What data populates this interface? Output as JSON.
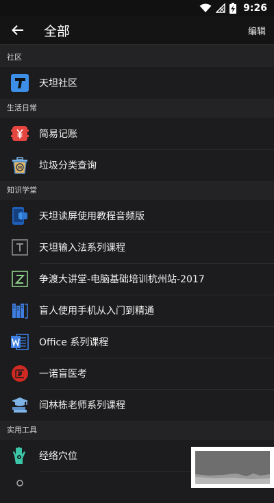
{
  "status_bar": {
    "time": "9:26"
  },
  "app_bar": {
    "title": "全部",
    "edit_label": "编辑"
  },
  "sections": [
    {
      "title": "社区",
      "items": [
        {
          "label": "天坦社区",
          "icon": "tiantan-t-icon"
        }
      ]
    },
    {
      "title": "生活日常",
      "items": [
        {
          "label": "简易记账",
          "icon": "yen-ledger-icon"
        },
        {
          "label": "垃圾分类查询",
          "icon": "trash-bin-icon"
        }
      ]
    },
    {
      "title": "知识学堂",
      "items": [
        {
          "label": "天坦读屏使用教程音频版",
          "icon": "phone-audio-icon"
        },
        {
          "label": "天坦输入法系列课程",
          "icon": "t-box-icon"
        },
        {
          "label": "争渡大讲堂-电脑基础培训杭州站-2017",
          "icon": "z-box-icon"
        },
        {
          "label": "盲人使用手机从入门到精通",
          "icon": "bookshelf-icon"
        },
        {
          "label": "Office 系列课程",
          "icon": "word-doc-icon"
        },
        {
          "label": "一诺盲医考",
          "icon": "medical-badge-icon"
        },
        {
          "label": "闫林栋老师系列课程",
          "icon": "graduation-books-icon"
        }
      ]
    },
    {
      "title": "实用工具",
      "items": [
        {
          "label": "经络穴位",
          "icon": "acupoint-hand-icon"
        }
      ]
    }
  ],
  "colors": {
    "background": "#1c1c1e",
    "section_bg": "#232325",
    "accent_blue": "#3d7ee0"
  }
}
